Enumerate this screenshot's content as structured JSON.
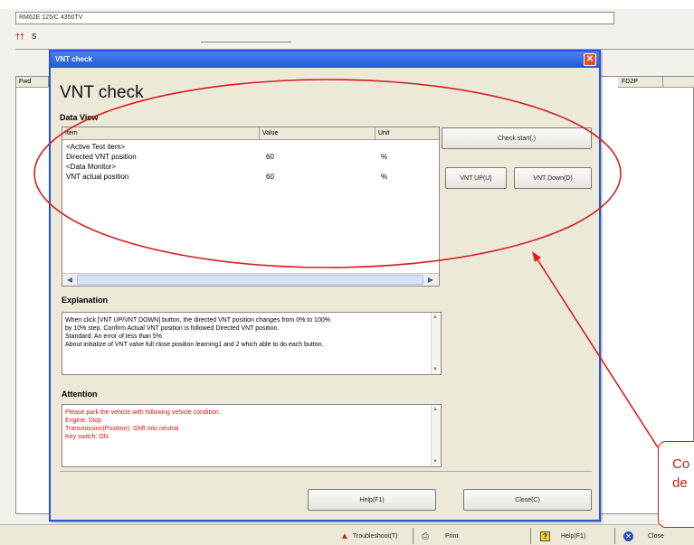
{
  "background": {
    "path_field": "RM62E 125/C 4350TV",
    "tab_label": "S",
    "list_header_left": "Fwd",
    "list_header_right": "FD2P"
  },
  "status_bar": {
    "troubleshoot_label": "Troubleshoot(T)",
    "print_label": "Print",
    "help_label": "Help(F1)",
    "close_label": "Close"
  },
  "dialog": {
    "title": "VNT check",
    "heading": "VNT check",
    "data_view": {
      "label": "Data View",
      "columns": [
        "Item",
        "Value",
        "Unit"
      ],
      "rows": [
        {
          "item": "<Active Test item>",
          "value": "",
          "unit": ""
        },
        {
          "item": "Directed VNT position",
          "value": "60",
          "unit": "%"
        },
        {
          "item": "<Data Monitor>",
          "value": "",
          "unit": ""
        },
        {
          "item": "VNT actual position",
          "value": "60",
          "unit": "%"
        }
      ]
    },
    "buttons": {
      "check_start": "Check start(.)",
      "vnt_up": "VNT UP(U)",
      "vnt_down": "VNT Down(D)",
      "help": "Help(F1)",
      "close": "Close(C)"
    },
    "explanation": {
      "label": "Explanation",
      "lines": [
        "When click [VNT UP/VNT DOWN] button, the directed VNT position changes from 0% to 100%",
        "by 10% step. Confirm Actual VNT position is followed Directed VNT position.",
        "Standard: An error of less than 5%",
        "About initialize of VNT valve full close position learning1 and 2 which able to do each button."
      ]
    },
    "attention": {
      "label": "Attention",
      "lines": [
        "Please park the vehicle with following vehicle condition.",
        "Engine: Stop",
        "Transmission(Position): Shift into neutral",
        "Key switch: ON"
      ]
    }
  },
  "annotation": {
    "callout_lines": "Co\nde",
    "color": "#c8201a"
  },
  "colors": {
    "title_bar": "#2458d8",
    "attention_text": "#e01010"
  }
}
